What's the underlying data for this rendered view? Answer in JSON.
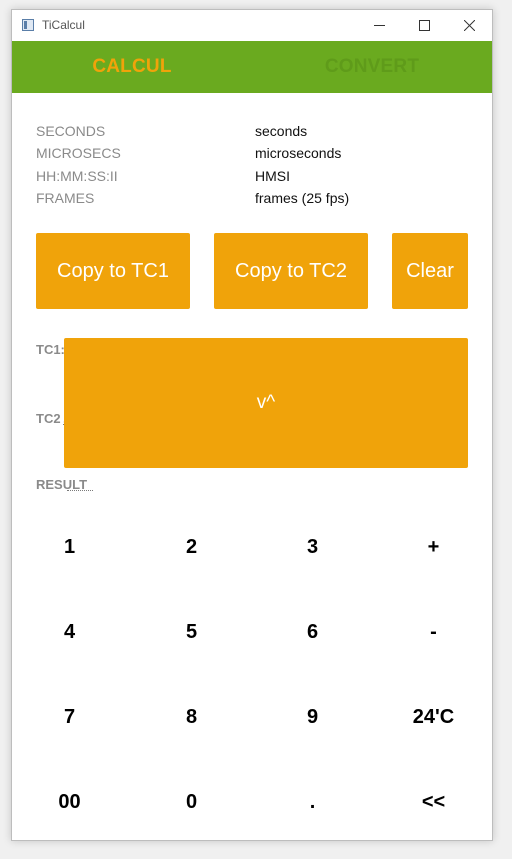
{
  "window": {
    "title": "TiCalcul",
    "minimize_glyph": "—",
    "maximize_glyph": "□",
    "close_glyph": "✕"
  },
  "tabs": [
    {
      "label": "CALCUL",
      "active": true
    },
    {
      "label": "CONVERT",
      "active": false
    }
  ],
  "info_rows": [
    {
      "key": "SECONDS",
      "value": "seconds"
    },
    {
      "key": "MICROSECS",
      "value": "microseconds"
    },
    {
      "key": "HH:MM:SS:II",
      "value": "HMSI"
    },
    {
      "key": "FRAMES",
      "value": "frames (25 fps)"
    }
  ],
  "actions": {
    "copy_tc1": "Copy to TC1",
    "copy_tc2": "Copy to TC2",
    "clear": "Clear"
  },
  "timecode": {
    "tc1_label": "TC1:",
    "tc2_label": "TC2",
    "tc2_value": ". : . : .",
    "result_label": "RESULT",
    "swap_label": "v^"
  },
  "keypad": [
    [
      "1",
      "2",
      "3",
      "+"
    ],
    [
      "4",
      "5",
      "6",
      "-"
    ],
    [
      "7",
      "8",
      "9",
      "24'C"
    ],
    [
      "00",
      "0",
      ".",
      "<<"
    ]
  ],
  "colors": {
    "accent": "#f0a30a",
    "tabbar": "#6aaa1f",
    "tab_inactive": "#5f9b1a",
    "label_gray": "#8a8a8a"
  }
}
